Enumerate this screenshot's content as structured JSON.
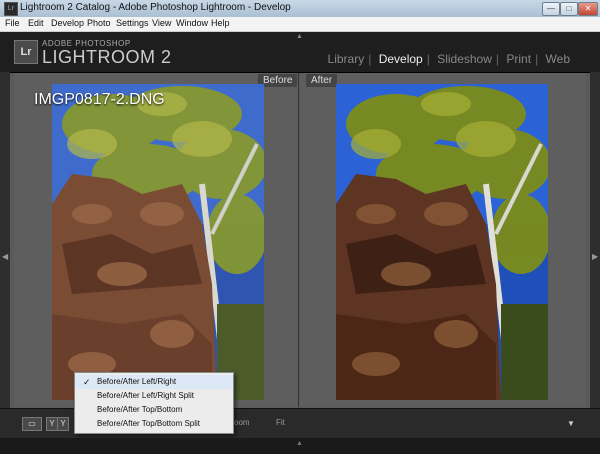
{
  "window": {
    "title": "Lightroom 2 Catalog - Adobe Photoshop Lightroom - Develop"
  },
  "menubar": {
    "items": [
      "File",
      "Edit",
      "Develop",
      "Photo",
      "Settings",
      "View",
      "Window",
      "Help"
    ]
  },
  "branding": {
    "top": "ADOBE PHOTOSHOP",
    "main": "LIGHTROOM 2",
    "logo": "Lr"
  },
  "modules": [
    {
      "label": "Library",
      "active": false
    },
    {
      "label": "Develop",
      "active": true
    },
    {
      "label": "Slideshow",
      "active": false
    },
    {
      "label": "Print",
      "active": false
    },
    {
      "label": "Web",
      "active": false
    }
  ],
  "panes": {
    "before_label": "Before",
    "after_label": "After",
    "filename": "IMGP0817-2.DNG"
  },
  "toolbar": {
    "view_y": "Y",
    "view_yy": "Y",
    "zoom_label": "oom",
    "fit_label": "Fit"
  },
  "context_menu": {
    "items": [
      {
        "label": "Before/After Left/Right",
        "checked": true
      },
      {
        "label": "Before/After Left/Right Split",
        "checked": false
      },
      {
        "label": "Before/After Top/Bottom",
        "checked": false
      },
      {
        "label": "Before/After Top/Bottom Split",
        "checked": false
      }
    ]
  },
  "colors": {
    "accent": "#eeeeee",
    "panel": "#5e5e5e",
    "background": "#2a2a2a"
  }
}
